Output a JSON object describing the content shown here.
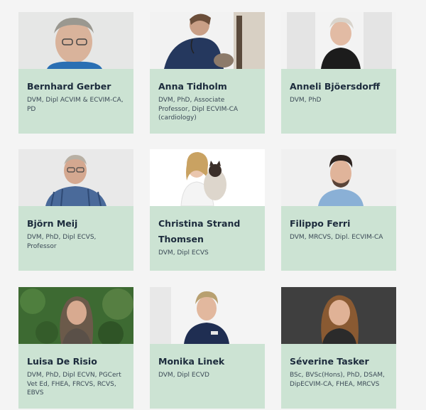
{
  "experts": [
    {
      "name": "Bernhard Gerber",
      "credentials": "DVM, Dipl ACVIM & ECVIM-CA, PD"
    },
    {
      "name": "Anna Tidholm",
      "credentials": "DVM, PhD, Associate Professor, Dipl ECVIM-CA (cardiology)"
    },
    {
      "name": "Anneli Bjöersdorff",
      "credentials": "DVM, PhD"
    },
    {
      "name": "Björn Meij",
      "credentials": "DVM, PhD, Dipl ECVS, Professor"
    },
    {
      "name": "Christina Strand Thomsen",
      "credentials": "DVM, Dipl ECVS"
    },
    {
      "name": "Filippo Ferri",
      "credentials": "DVM, MRCVS, Dipl. ECVIM-CA"
    },
    {
      "name": "Luisa De Risio",
      "credentials": "DVM, PhD, Dipl ECVN, PGCert Vet Ed, FHEA, FRCVS, RCVS, EBVS"
    },
    {
      "name": "Monika Linek",
      "credentials": "DVM, Dipl ECVD"
    },
    {
      "name": "Séverine Tasker",
      "credentials": "BSc, BVSc(Hons), PhD, DSAM, DipECVIM-CA, FHEA, MRCVS"
    }
  ],
  "colors": {
    "card_background": "#cce3d3",
    "name_text": "#1c2b3c",
    "credentials_text": "#3b4a56",
    "page_background": "#f4f4f4"
  }
}
